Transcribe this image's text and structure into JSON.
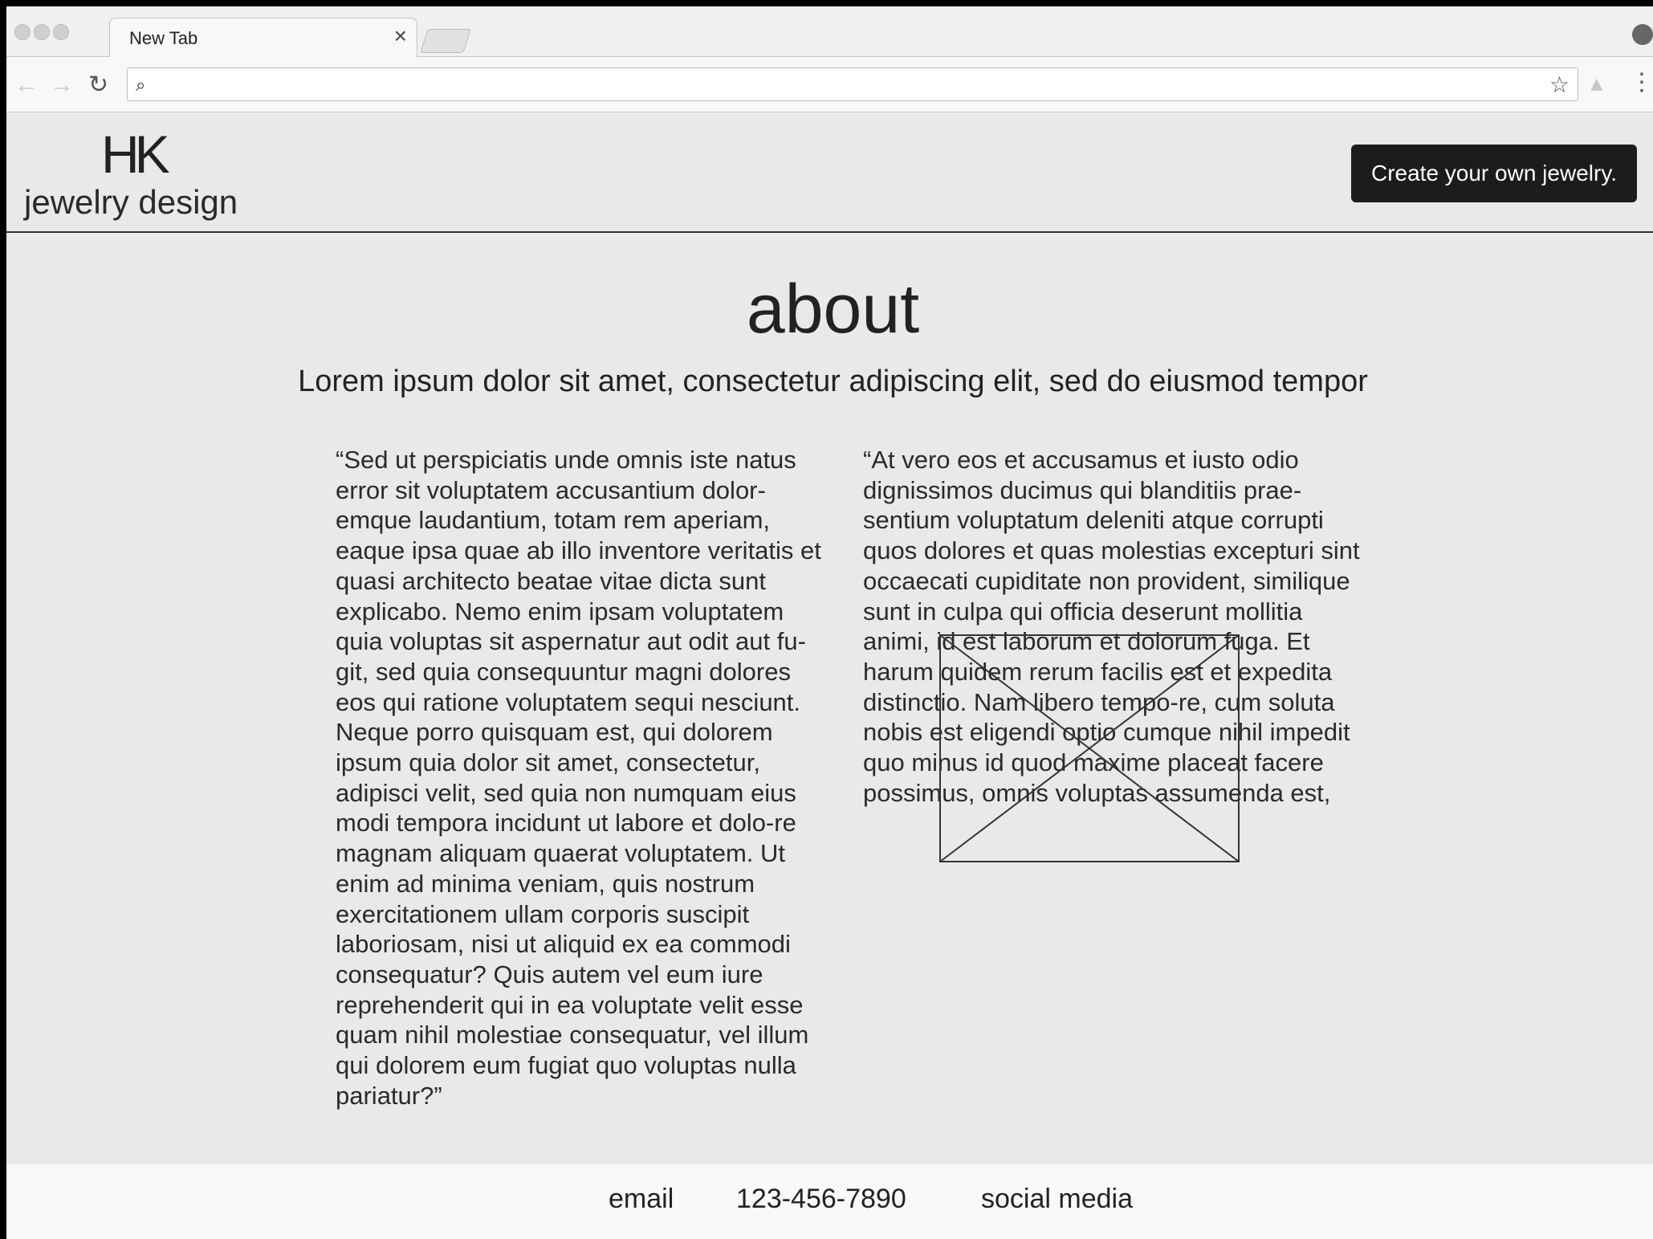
{
  "browser": {
    "tab_title": "New Tab",
    "tab_close": "×",
    "address_value": "",
    "address_placeholder": ""
  },
  "header": {
    "logo_mark": "HK",
    "logo_sub": "jewelry design",
    "cta_label": "Create your own jewelry."
  },
  "about": {
    "title": "about",
    "subtitle": "Lorem ipsum dolor sit amet, consectetur adipiscing elit, sed do eiusmod tempor",
    "col_left": "“Sed ut perspiciatis unde omnis iste natus error sit voluptatem accusantium dolor-emque laudantium, totam rem aperiam, eaque ipsa quae ab illo inventore veritatis et quasi architecto beatae vitae dicta sunt explicabo. Nemo enim ipsam voluptatem quia voluptas sit aspernatur aut odit aut fu-git, sed quia consequuntur magni dolores eos qui ratione voluptatem sequi nesciunt. Neque porro quisquam est, qui dolorem ipsum quia dolor sit amet, consectetur, adipisci velit, sed quia non numquam eius modi tempora incidunt ut labore et dolo-re magnam aliquam quaerat voluptatem. Ut enim ad minima veniam, quis nostrum exercitationem ullam corporis suscipit laboriosam, nisi ut aliquid ex ea commodi consequatur? Quis autem vel eum iure reprehenderit qui in ea voluptate velit esse quam nihil molestiae consequatur, vel illum qui dolorem eum fugiat quo voluptas nulla pariatur?”",
    "col_right": "“At vero eos et accusamus et iusto odio dignissimos ducimus qui blanditiis prae-sentium voluptatum deleniti atque corrupti quos dolores et quas molestias excepturi sint occaecati cupiditate non provident, similique sunt in culpa qui officia deserunt mollitia animi, id est laborum et dolorum fuga. Et harum quidem rerum facilis est et expedita distinctio. Nam libero tempo-re, cum soluta nobis est eligendi optio cumque nihil impedit quo minus id quod maxime placeat facere possimus, omnis voluptas assumenda est,"
  },
  "footer": {
    "email": "email",
    "phone": "123-456-7890",
    "social": "social media"
  },
  "icons": {
    "back": "back-arrow-icon",
    "forward": "forward-arrow-icon",
    "reload": "reload-icon",
    "search": "search-icon",
    "star": "star-icon",
    "drive": "drive-icon",
    "menu": "kebab-menu-icon",
    "profile": "profile-icon",
    "image": "image-placeholder-icon"
  },
  "colors": {
    "page_bg": "#e8e9eb",
    "cta_bg": "#1e1b1c",
    "footer_bg": "#f9f9f9"
  }
}
